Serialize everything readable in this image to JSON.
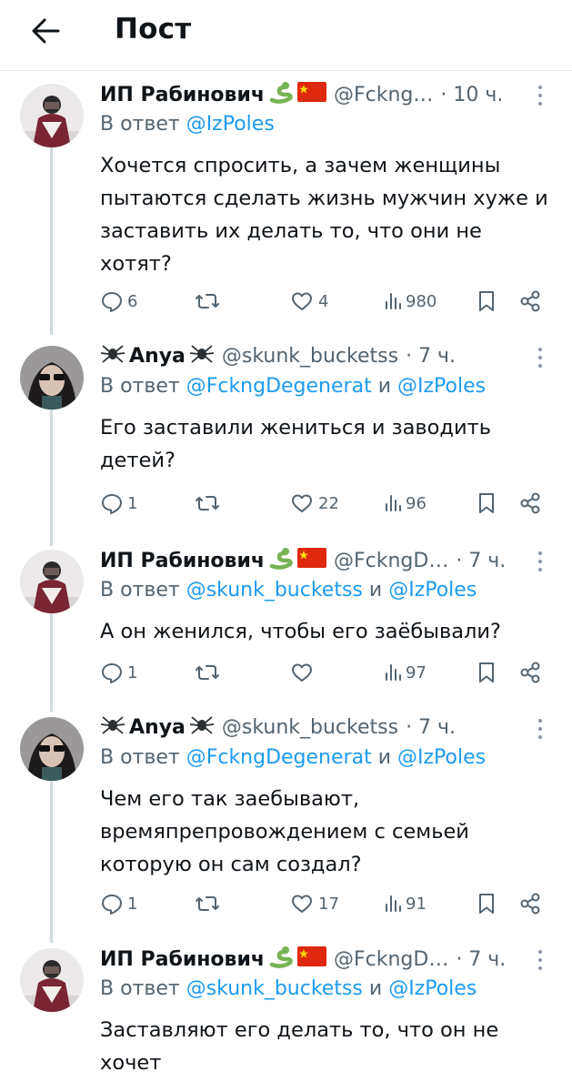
{
  "header": {
    "title": "Пост"
  },
  "tweets": [
    {
      "name": "ИП Рабинович",
      "handle": "@Fckng…",
      "time": "· 10 ч.",
      "reply_prefix": "В ответ",
      "mentions": [
        "@IzPoles"
      ],
      "text_lines": [
        "Хочется спросить, а зачем женщины",
        "пытаются сделать жизнь мужчин хуже и",
        "заставить их делать то, что они не",
        "хотят?"
      ],
      "replies": "6",
      "retweets": "",
      "likes": "4",
      "views": "980"
    },
    {
      "name": "Anya",
      "handle": "@skunk_bucketss",
      "time": "· 7 ч.",
      "reply_prefix": "В ответ",
      "mentions": [
        "@FckngDegenerat",
        "@IzPoles"
      ],
      "conjunction": "и",
      "text_lines": [
        "Его заставили жениться и заводить",
        "детей?"
      ],
      "replies": "1",
      "retweets": "",
      "likes": "22",
      "views": "96"
    },
    {
      "name": "ИП Рабинович",
      "handle": "@FckngD…",
      "time": "· 7 ч.",
      "reply_prefix": "В ответ",
      "mentions": [
        "@skunk_bucketss",
        "@IzPoles"
      ],
      "conjunction": "и",
      "text_lines": [
        "А он женился, чтобы его заёбывали?"
      ],
      "replies": "1",
      "retweets": "",
      "likes": "",
      "views": "97"
    },
    {
      "name": "Anya",
      "handle": "@skunk_bucketss",
      "time": "· 7 ч.",
      "reply_prefix": "В ответ",
      "mentions": [
        "@FckngDegenerat",
        "@IzPoles"
      ],
      "conjunction": "и",
      "text_lines": [
        "Чем его так заебывают,",
        "времяпрепровождением с семьей",
        "которую он сам создал?"
      ],
      "replies": "1",
      "retweets": "",
      "likes": "17",
      "views": "91"
    },
    {
      "name": "ИП Рабинович",
      "handle": "@FckngD…",
      "time": "· 7 ч.",
      "reply_prefix": "В ответ",
      "mentions": [
        "@skunk_bucketss",
        "@IzPoles"
      ],
      "conjunction": "и",
      "text_lines": [
        "Заставляют его делать то, что он не",
        "хочет"
      ]
    }
  ],
  "icons": {
    "back": "arrow-left-icon",
    "more": "more-vertical-icon",
    "reply": "comment-icon",
    "retweet": "retweet-icon",
    "like": "heart-icon",
    "views": "views-icon",
    "bookmark": "bookmark-icon",
    "share": "share-icon",
    "snake": "snake-emoji-icon",
    "flag": "china-flag-icon",
    "spider": "spider-emoji-icon"
  },
  "colors": {
    "link": "#1d9bf0",
    "muted": "#536471",
    "text": "#0f1419",
    "thread": "#cfd9de"
  }
}
